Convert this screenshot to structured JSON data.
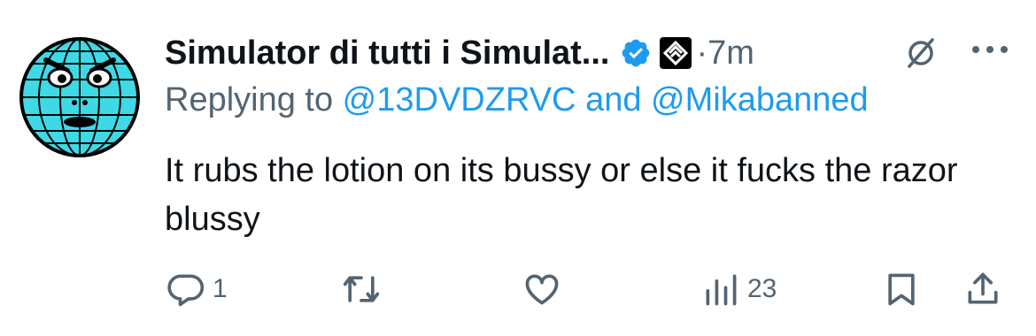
{
  "tweet": {
    "display_name": "Simulator di tutti i Simulat...",
    "time_separator": "·",
    "time": "7m",
    "replying_prefix": "Replying to ",
    "mention_1": "@13DVDZRVC",
    "replying_join": " and ",
    "mention_2": "@Mikabanned",
    "text": "It rubs the lotion on its bussy or else it fucks the razor blussy"
  },
  "actions": {
    "reply_count": "1",
    "retweet_count": "",
    "like_count": "",
    "views_count": "23"
  },
  "icons": {
    "avatar": "cyan-globe-face-avatar",
    "verified": "verified-badge-icon",
    "affiliation": "affiliation-logo-icon",
    "grok": "grok-icon",
    "more": "more-icon",
    "reply": "reply-icon",
    "retweet": "retweet-icon",
    "like": "heart-icon",
    "views": "views-icon",
    "bookmark": "bookmark-icon",
    "share": "share-icon"
  },
  "colors": {
    "text_primary": "#0f1419",
    "text_secondary": "#536471",
    "link": "#1d9bf0",
    "avatar_fill": "#3fd9e6"
  }
}
